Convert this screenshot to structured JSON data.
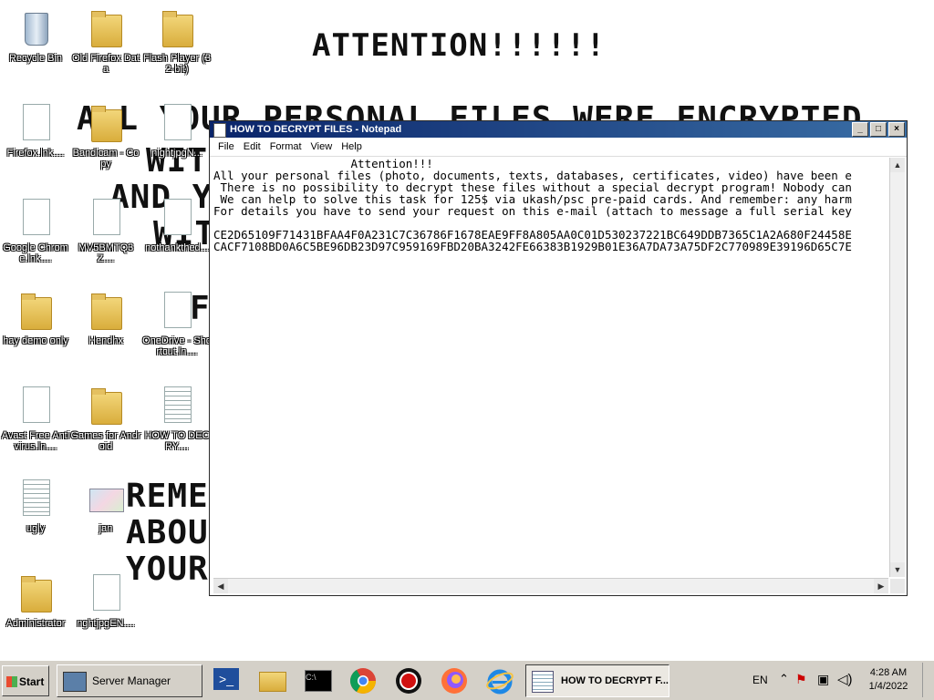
{
  "wallpaper": {
    "title": "ATTENTION!!!!!!",
    "line1": "ALL YOUR PERSONAL FILES WERE ENCRYPTED",
    "line2": "WIT",
    "line3": "AND Y",
    "line4": "WIT",
    "line5": "F",
    "line6": "REME",
    "line7": "ABOU",
    "line8": "YOUR"
  },
  "desktop_icons": [
    {
      "label": "Recycle Bin",
      "icon": "recycle-bin-icon"
    },
    {
      "label": "Old Firefox Data",
      "icon": "folder-icon"
    },
    {
      "label": "Flash Player (32-bit)",
      "icon": "folder-icon"
    },
    {
      "label": "Firefox.lnk....",
      "icon": "file-icon"
    },
    {
      "label": "Bandicam - Copy",
      "icon": "folder-icon"
    },
    {
      "label": "nightjpgN...",
      "icon": "file-icon"
    },
    {
      "label": "Google Chrome.lnk....",
      "icon": "file-icon"
    },
    {
      "label": "MV5BMTQ3Z....",
      "icon": "file-icon"
    },
    {
      "label": "nothankthed...",
      "icon": "file-icon"
    },
    {
      "label": "hay demo only",
      "icon": "folder-icon"
    },
    {
      "label": "Hendhx",
      "icon": "folder-icon"
    },
    {
      "label": "OneDrive - Shortcut.ln....",
      "icon": "file-icon"
    },
    {
      "label": "Avast Free Antivirus.ln....",
      "icon": "file-icon"
    },
    {
      "label": "Games for Android",
      "icon": "folder-icon"
    },
    {
      "label": "HOW TO DECRY....",
      "icon": "text-file-icon"
    },
    {
      "label": "ugly",
      "icon": "text-file-icon"
    },
    {
      "label": "jan",
      "icon": "image-icon"
    },
    {
      "label": "Administrator",
      "icon": "folder-icon"
    },
    {
      "label": "nghtjpgEN....",
      "icon": "file-icon"
    }
  ],
  "notepad": {
    "title": "HOW TO DECRYPT FILES - Notepad",
    "menu": [
      "File",
      "Edit",
      "Format",
      "View",
      "Help"
    ],
    "lines": [
      "                    Attention!!!",
      "All your personal files (photo, documents, texts, databases, certificates, video) have been e",
      " There is no possibility to decrypt these files without a special decrypt program! Nobody can",
      " We can help to solve this task for 125$ via ukash/psc pre-paid cards. And remember: any harm",
      "For details you have to send your request on this e-mail (attach to message a full serial key",
      "",
      "CE2D65109F71431BFAA4F0A231C7C36786F1678EAE9FF8A805AA0C01D530237221BC649DDB7365C1A2A680F24458E",
      "CACF7108BD0A6C5BE96DB23D97C959169FBD20BA3242FE66383B1929B01E36A7DA73A75DF2C770989E39196D65C7E"
    ]
  },
  "taskbar": {
    "start": "Start",
    "server_manager": "Server Manager",
    "active_task": "HOW TO DECRYPT F...",
    "lang": "EN",
    "time": "4:28 AM",
    "date": "1/4/2022"
  }
}
